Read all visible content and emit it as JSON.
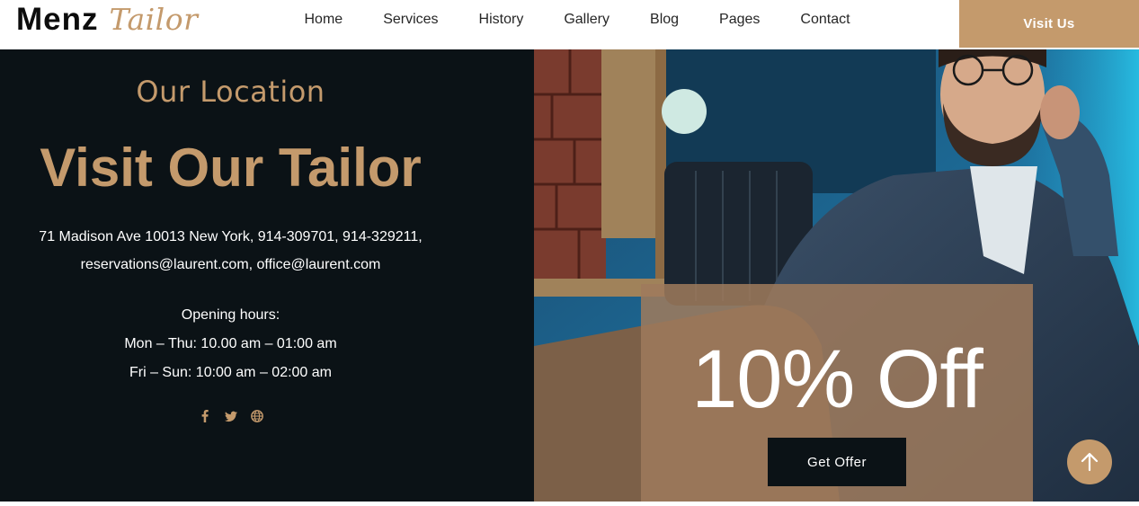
{
  "header": {
    "logo_main": "Menz",
    "logo_script": "Tailor",
    "nav": [
      "Home",
      "Services",
      "History",
      "Gallery",
      "Blog",
      "Pages",
      "Contact"
    ],
    "cta_label": "Visit Us"
  },
  "location": {
    "subtitle": "Our Location",
    "title": "Visit Our Tailor",
    "address_line1": "71 Madison Ave 10013 New York, 914-309701, 914-329211,",
    "address_line2": "reservations@laurent.com, office@laurent.com",
    "hours_label": "Opening hours:",
    "hours_weekday": "Mon – Thu: 10.00 am – 01:00 am",
    "hours_weekend": "Fri – Sun: 10:00 am – 02:00 am",
    "socials": [
      "facebook-icon",
      "twitter-icon",
      "globe-icon"
    ]
  },
  "offer": {
    "headline": "10% Off",
    "button_label": "Get Offer"
  },
  "colors": {
    "accent": "#c49a6c",
    "dark": "#0b1216",
    "offer_overlay": "#9e7a5c"
  }
}
